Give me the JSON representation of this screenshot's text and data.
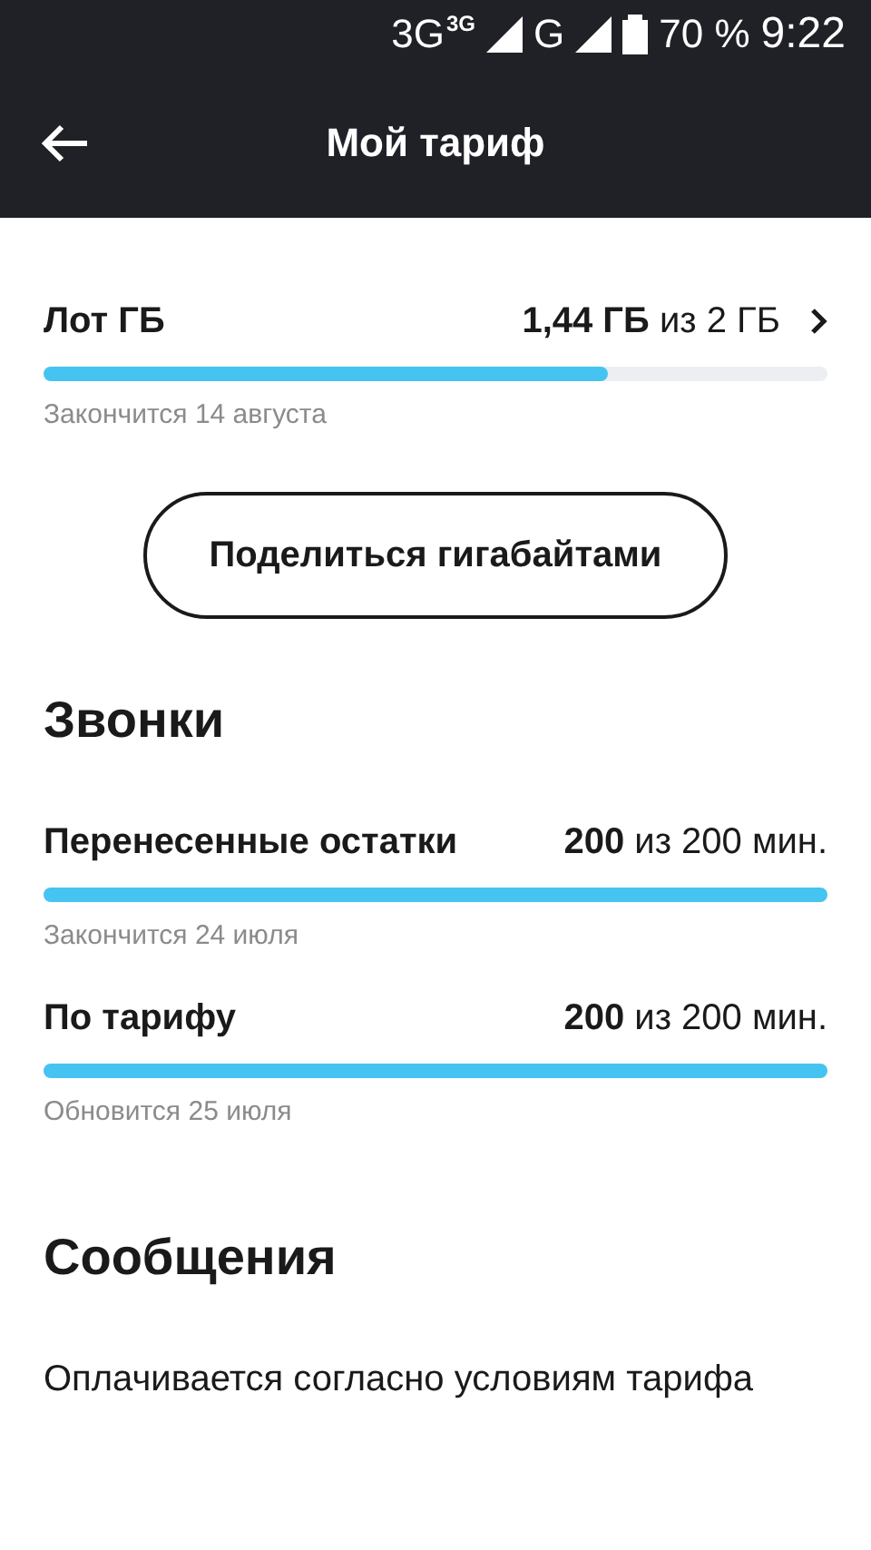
{
  "status_bar": {
    "network_1": "3G",
    "network_1_sub": "3G",
    "network_2": "G",
    "battery": "70 %",
    "time": "9:22"
  },
  "header": {
    "title": "Мой тариф"
  },
  "internet": {
    "name": "Лот ГБ",
    "value": "**1,44 ГБ** из 2 ГБ",
    "level": 0.72,
    "note": "Закончится 14 августа"
  },
  "share_button": "Поделиться гигабайтами",
  "calls": {
    "title": "Звонки",
    "items": [
      {
        "name": "Перенесенные остатки",
        "value": "**200** из 200 мин.",
        "level": 1,
        "note": "Закончится 24 июля"
      },
      {
        "name": "По тарифу",
        "value": "**200** из 200 мин.",
        "level": 1,
        "note": "Обновится 25 июля"
      }
    ]
  },
  "messages": {
    "title": "Сообщения",
    "text": "Оплачивается согласно условиям тарифа"
  }
}
